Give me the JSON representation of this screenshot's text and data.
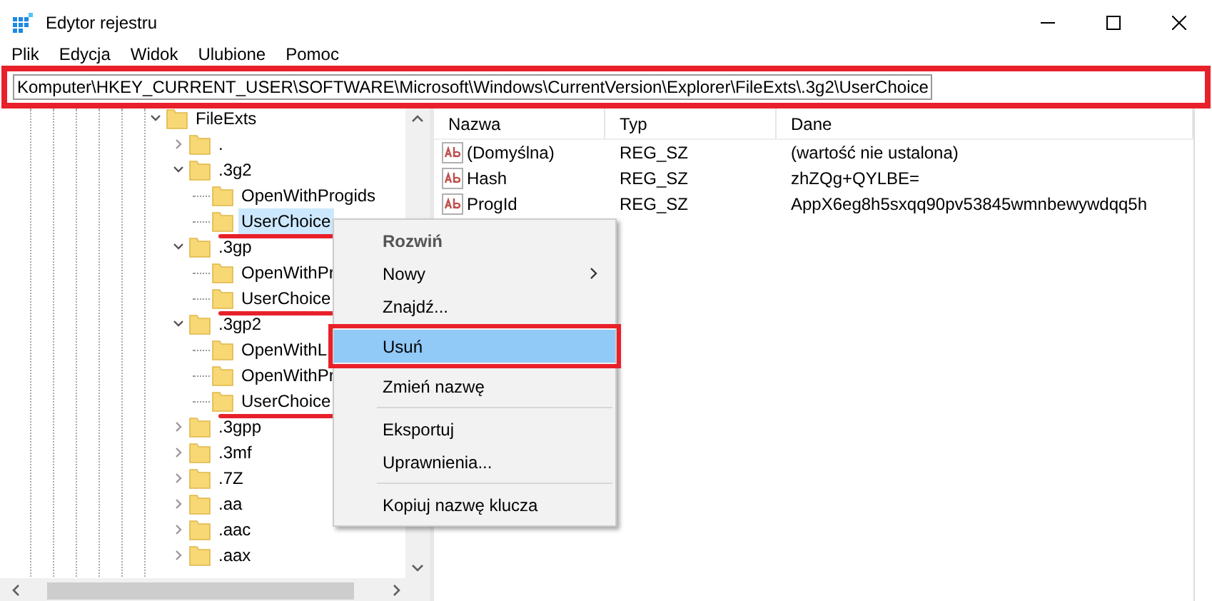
{
  "window": {
    "title": "Edytor rejestru"
  },
  "menu": [
    "Plik",
    "Edycja",
    "Widok",
    "Ulubione",
    "Pomoc"
  ],
  "address_bar": {
    "value": "Komputer\\HKEY_CURRENT_USER\\SOFTWARE\\Microsoft\\Windows\\CurrentVersion\\Explorer\\FileExts\\.3g2\\UserChoice",
    "annotated": true
  },
  "tree": [
    {
      "label": "FileExts",
      "expanded": true,
      "selected": false,
      "children": [
        {
          "label": ".",
          "expanded": false,
          "selected": false
        },
        {
          "label": ".3g2",
          "expanded": true,
          "selected": false,
          "children": [
            {
              "label": "OpenWithProgids",
              "selected": false
            },
            {
              "label": "UserChoice",
              "selected": true,
              "annotated": true
            }
          ]
        },
        {
          "label": ".3gp",
          "expanded": true,
          "selected": false,
          "children": [
            {
              "label": "OpenWithPr",
              "selected": false
            },
            {
              "label": "UserChoice",
              "selected": false,
              "annotated": true
            }
          ]
        },
        {
          "label": ".3gp2",
          "expanded": true,
          "selected": false,
          "children": [
            {
              "label": "OpenWithL",
              "selected": false
            },
            {
              "label": "OpenWithPr",
              "selected": false
            },
            {
              "label": "UserChoice",
              "selected": false,
              "annotated": true
            }
          ]
        },
        {
          "label": ".3gpp",
          "expanded": false,
          "selected": false
        },
        {
          "label": ".3mf",
          "expanded": false,
          "selected": false
        },
        {
          "label": ".7Z",
          "expanded": false,
          "selected": false
        },
        {
          "label": ".aa",
          "expanded": false,
          "selected": false
        },
        {
          "label": ".aac",
          "expanded": false,
          "selected": false
        },
        {
          "label": ".aax",
          "expanded": false,
          "selected": false
        }
      ]
    }
  ],
  "values_table": {
    "columns": [
      "Nazwa",
      "Typ",
      "Dane"
    ],
    "rows": [
      {
        "name": "(Domyślna)",
        "type": "REG_SZ",
        "data": "(wartość nie ustalona)"
      },
      {
        "name": "Hash",
        "type": "REG_SZ",
        "data": "zhZQg+QYLBE="
      },
      {
        "name": "ProgId",
        "type": "REG_SZ",
        "data": "AppX6eg8h5sxqq90pv53845wmnbewywdqq5h"
      }
    ]
  },
  "context_menu": {
    "items": [
      {
        "kind": "item",
        "label": "Rozwiń",
        "default": true,
        "submenu": false,
        "selected": false,
        "annotated": false
      },
      {
        "kind": "item",
        "label": "Nowy",
        "default": false,
        "submenu": true,
        "selected": false,
        "annotated": false
      },
      {
        "kind": "item",
        "label": "Znajdź...",
        "default": false,
        "submenu": false,
        "selected": false,
        "annotated": false
      },
      {
        "kind": "item",
        "label": "Usuń",
        "default": false,
        "submenu": false,
        "selected": true,
        "annotated": true
      },
      {
        "kind": "item",
        "label": "Zmień nazwę",
        "default": false,
        "submenu": false,
        "selected": false,
        "annotated": false
      },
      {
        "kind": "separator"
      },
      {
        "kind": "item",
        "label": "Eksportuj",
        "default": false,
        "submenu": false,
        "selected": false,
        "annotated": false
      },
      {
        "kind": "item",
        "label": "Uprawnienia...",
        "default": false,
        "submenu": false,
        "selected": false,
        "annotated": false
      },
      {
        "kind": "separator"
      },
      {
        "kind": "item",
        "label": "Kopiuj nazwę klucza",
        "default": false,
        "submenu": false,
        "selected": false,
        "annotated": false
      }
    ]
  }
}
